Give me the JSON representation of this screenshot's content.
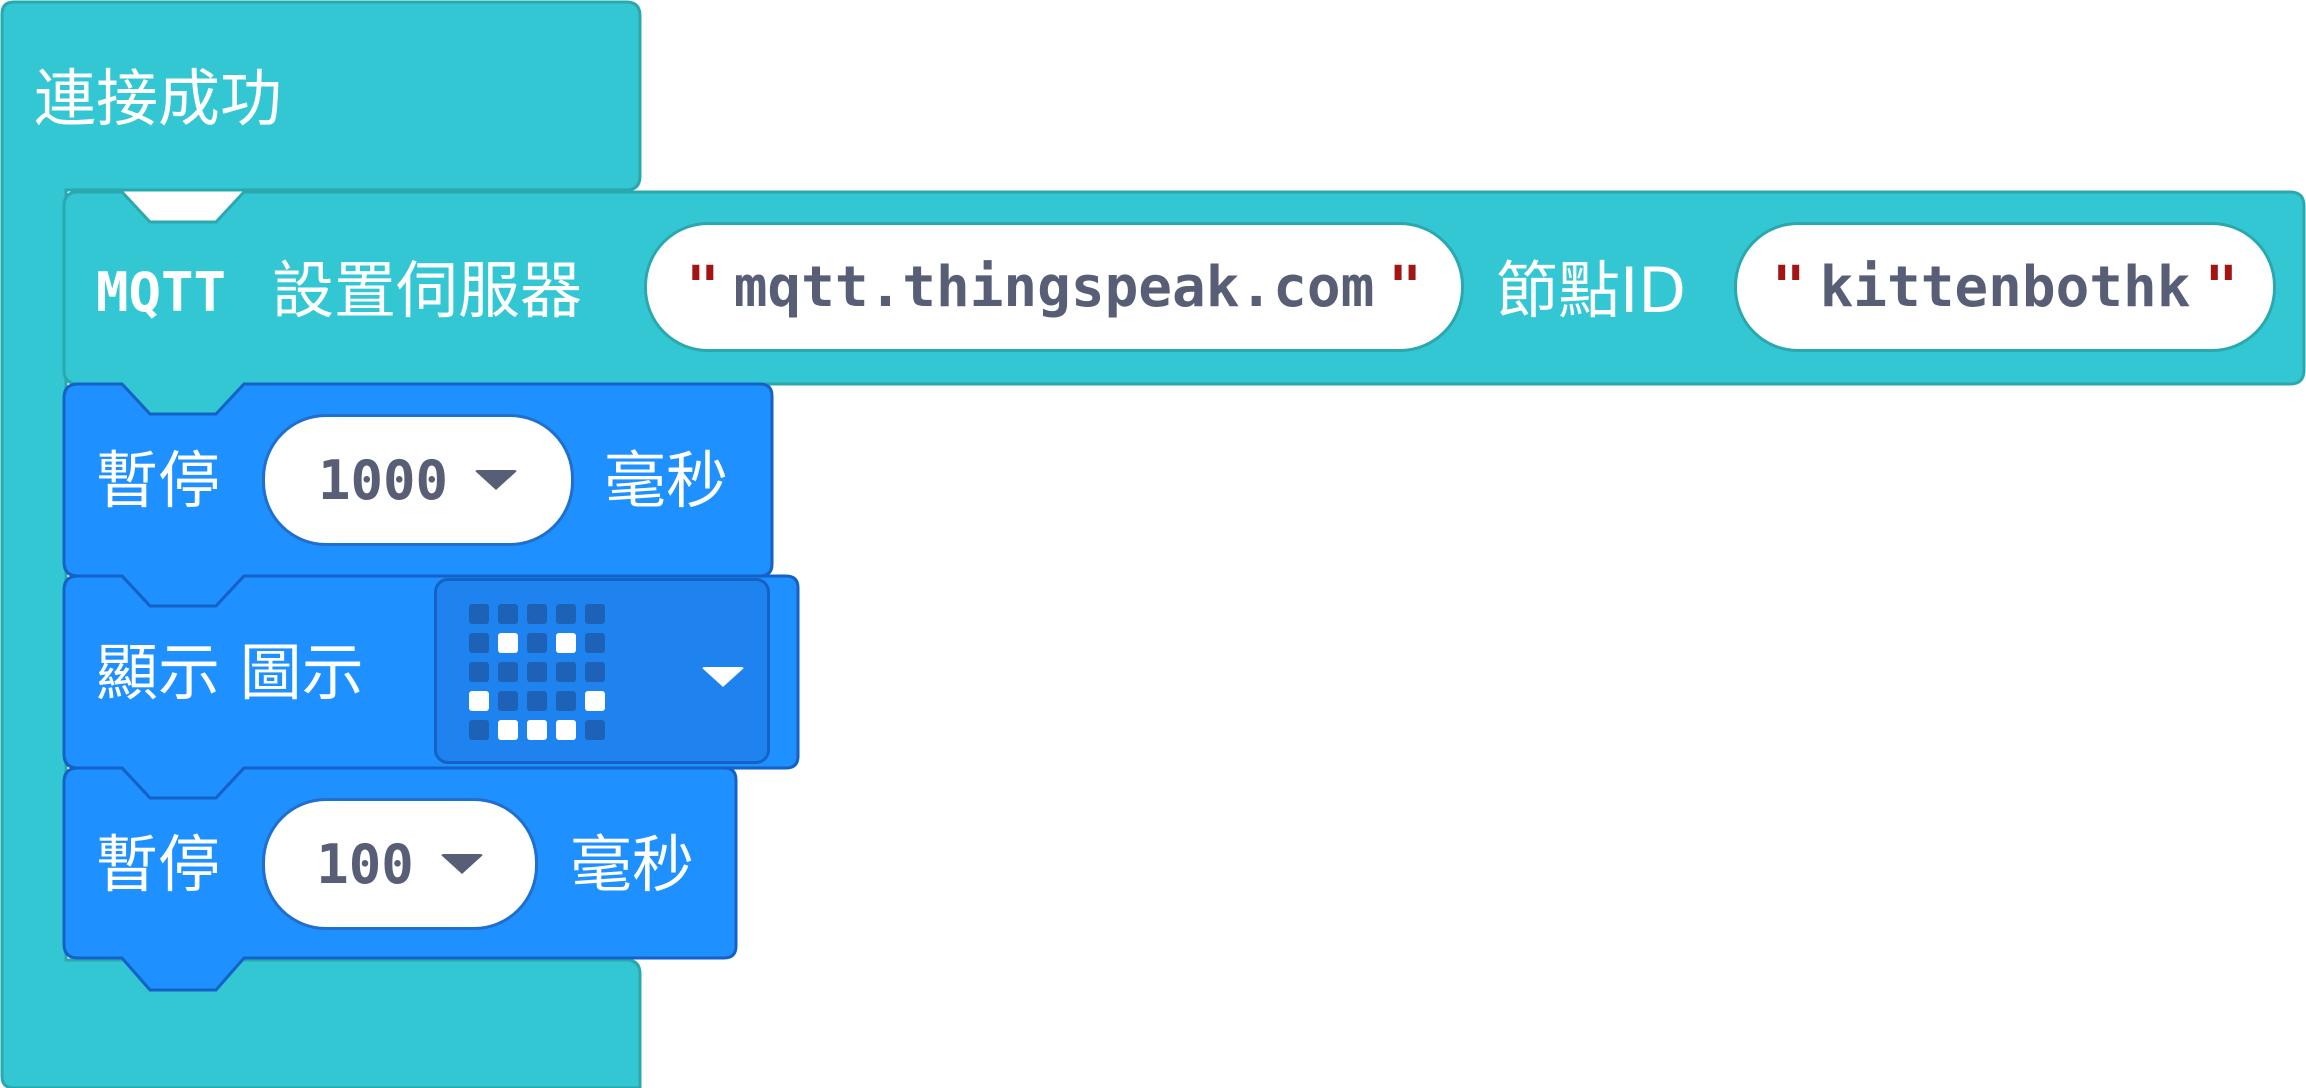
{
  "colors": {
    "event_block": "#33c7d4",
    "event_border": "#2aa8ae",
    "basic_block": "#1e90ff",
    "basic_border": "#1462c6",
    "field_text": "#575e75",
    "quote": "#a31515"
  },
  "event_block": {
    "title": "連接成功"
  },
  "mqtt_block": {
    "prefix": "MQTT",
    "label_server": "設置伺服器",
    "server_value": "mqtt.thingspeak.com",
    "label_node": "節點ID",
    "node_value": "kittenbothk",
    "quote_char": "\""
  },
  "pause_block_1": {
    "label": "暫停",
    "value": "1000",
    "unit": "毫秒"
  },
  "show_icon_block": {
    "label": "顯示 圖示",
    "icon_name": "sad-face-icon",
    "leds": [
      [
        0,
        0,
        0,
        0,
        0
      ],
      [
        0,
        1,
        0,
        1,
        0
      ],
      [
        0,
        0,
        0,
        0,
        0
      ],
      [
        1,
        0,
        0,
        0,
        1
      ],
      [
        0,
        1,
        1,
        1,
        0
      ]
    ]
  },
  "pause_block_2": {
    "label": "暫停",
    "value": "100",
    "unit": "毫秒"
  }
}
